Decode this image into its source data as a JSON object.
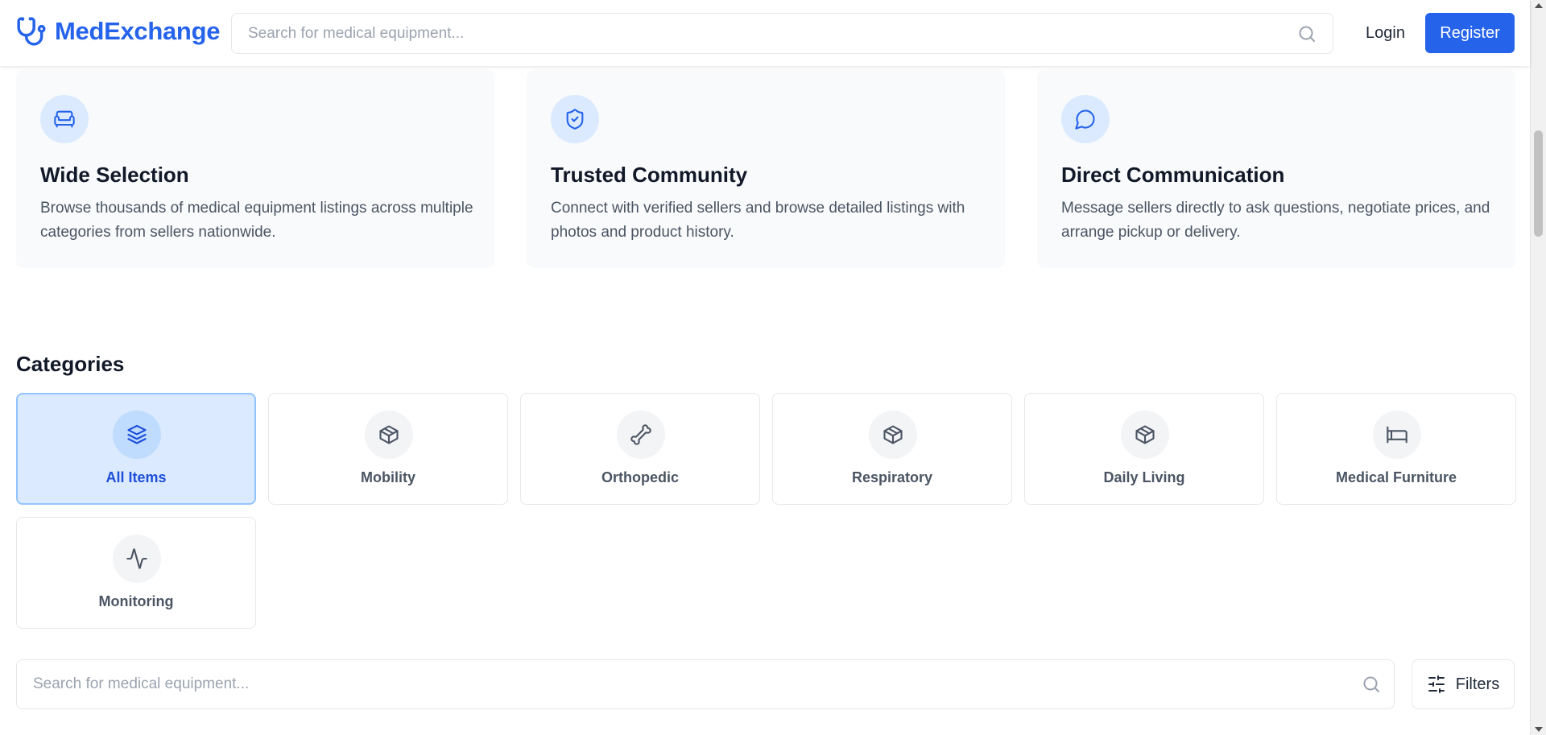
{
  "header": {
    "brand": "MedExchange",
    "search_placeholder": "Search for medical equipment...",
    "login_label": "Login",
    "register_label": "Register"
  },
  "features": [
    {
      "icon": "sofa-icon",
      "title": "Wide Selection",
      "text": "Browse thousands of medical equipment listings across multiple categories from sellers nationwide."
    },
    {
      "icon": "shield-check-icon",
      "title": "Trusted Community",
      "text": "Connect with verified sellers and browse detailed listings with photos and product history."
    },
    {
      "icon": "message-circle-icon",
      "title": "Direct Communication",
      "text": "Message sellers directly to ask questions, negotiate prices, and arrange pickup or delivery."
    }
  ],
  "categories": {
    "title": "Categories",
    "items": [
      {
        "label": "All Items",
        "icon": "layers-icon",
        "active": true
      },
      {
        "label": "Mobility",
        "icon": "package-icon",
        "active": false
      },
      {
        "label": "Orthopedic",
        "icon": "bone-icon",
        "active": false
      },
      {
        "label": "Respiratory",
        "icon": "package-icon",
        "active": false
      },
      {
        "label": "Daily Living",
        "icon": "package-icon",
        "active": false
      },
      {
        "label": "Medical Furniture",
        "icon": "bed-icon",
        "active": false
      },
      {
        "label": "Monitoring",
        "icon": "activity-icon",
        "active": false
      }
    ]
  },
  "listing_search": {
    "placeholder": "Search for medical equipment...",
    "filters_label": "Filters"
  },
  "colors": {
    "brand": "#2563eb",
    "active_bg": "#dbeafe",
    "active_border": "#93c5fd",
    "feature_bg": "#f8fafc"
  }
}
